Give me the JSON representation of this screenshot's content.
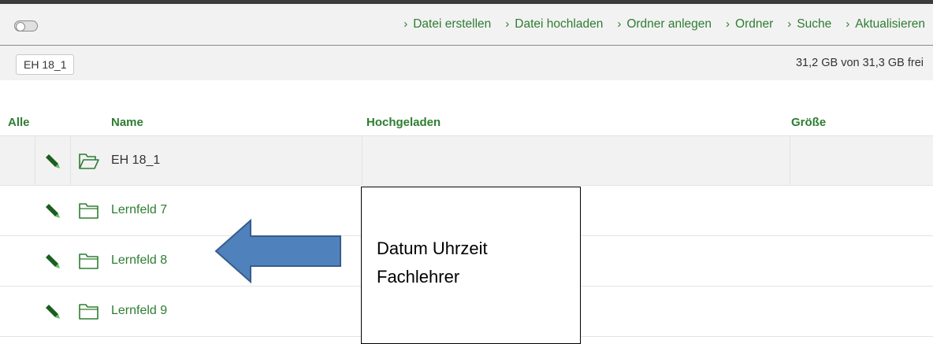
{
  "toolbar": {
    "toggle_state": "off",
    "actions": [
      {
        "label": "Datei erstellen",
        "icon": "chevron-right-icon"
      },
      {
        "label": "Datei hochladen",
        "icon": "chevron-right-icon"
      },
      {
        "label": "Ordner anlegen",
        "icon": "chevron-right-icon"
      },
      {
        "label": "Ordner",
        "icon": "chevron-right-icon"
      },
      {
        "label": "Suche",
        "icon": "chevron-right-icon"
      },
      {
        "label": "Aktualisieren",
        "icon": "chevron-right-icon"
      }
    ]
  },
  "breadcrumb": {
    "current": "EH 18_1",
    "free_space": "31,2 GB von 31,3 GB frei"
  },
  "table": {
    "columns": {
      "all": "Alle",
      "name": "Name",
      "uploaded": "Hochgeladen",
      "size": "Größe"
    },
    "rows": [
      {
        "name": "EH 18_1",
        "folder_icon": "folder-open-icon",
        "edit_icon": "pencil-icon",
        "uploaded": "",
        "size": ""
      },
      {
        "name": "Lernfeld 7",
        "folder_icon": "folder-icon",
        "edit_icon": "pencil-icon",
        "uploaded": "",
        "size": ""
      },
      {
        "name": "Lernfeld 8",
        "folder_icon": "folder-icon",
        "edit_icon": "pencil-icon",
        "uploaded": "",
        "size": ""
      },
      {
        "name": "Lernfeld 9",
        "folder_icon": "folder-icon",
        "edit_icon": "pencil-icon",
        "uploaded": "",
        "size": ""
      }
    ]
  },
  "annotation": {
    "line1": "Datum Uhrzeit",
    "line2": "Fachlehrer",
    "arrow_color": "#4f81bd",
    "arrow_outline": "#385d8a"
  },
  "colors": {
    "accent_green": "#2e7d32",
    "toolbar_bg": "#f2f2f2"
  }
}
